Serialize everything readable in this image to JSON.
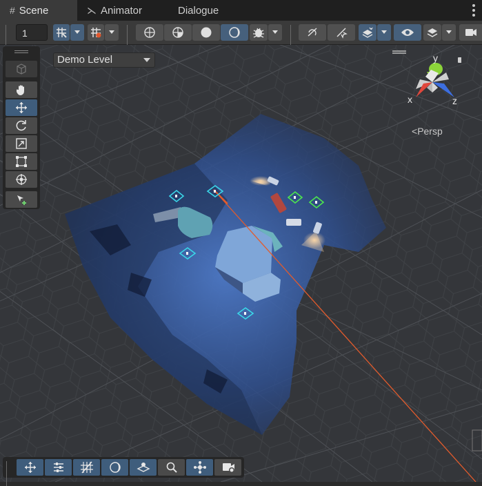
{
  "tabs": [
    {
      "label": "Scene",
      "icon": "scene-grid-icon",
      "active": true
    },
    {
      "label": "Animator",
      "icon": "animator-icon",
      "active": false
    },
    {
      "label": "Dialogue",
      "icon": "",
      "active": false
    }
  ],
  "toolbar": {
    "layer_value": "1",
    "buttons": [
      "grid-snap-icon",
      "snap-increment-icon",
      "wireframe-shading-icon",
      "shaded-wireframe-icon",
      "shaded-icon",
      "lighting-icon",
      "gizmos-bug-icon",
      "audio-mute-icon",
      "effects-icon",
      "scene-visibility-icon",
      "view-eye-icon",
      "layers-icon",
      "camera-icon"
    ]
  },
  "viewport": {
    "level_dropdown": "Demo Level",
    "projection_label": "Persp",
    "gizmo_axes": {
      "x": "x",
      "y": "y",
      "z": "z"
    },
    "colors": {
      "x_axis": "#e0473c",
      "y_axis": "#8cd43a",
      "z_axis": "#3c6ee0",
      "selection_line": "#e25b2c",
      "light_marker": "#3ad6e8",
      "green_marker": "#4de84d"
    }
  },
  "left_tools": [
    "view-cube-icon",
    "hand-icon",
    "move-icon",
    "rotate-icon",
    "scale-icon",
    "rect-tool-icon",
    "transform-icon",
    "custom-tool-icon"
  ],
  "bottom_overlays": [
    "move-overlay-icon",
    "tool-settings-icon",
    "grid-visibility-icon",
    "lighting-overlay-icon",
    "orientation-overlay-icon",
    "search-icon",
    "pivot-icon",
    "camera-preview-icon"
  ]
}
